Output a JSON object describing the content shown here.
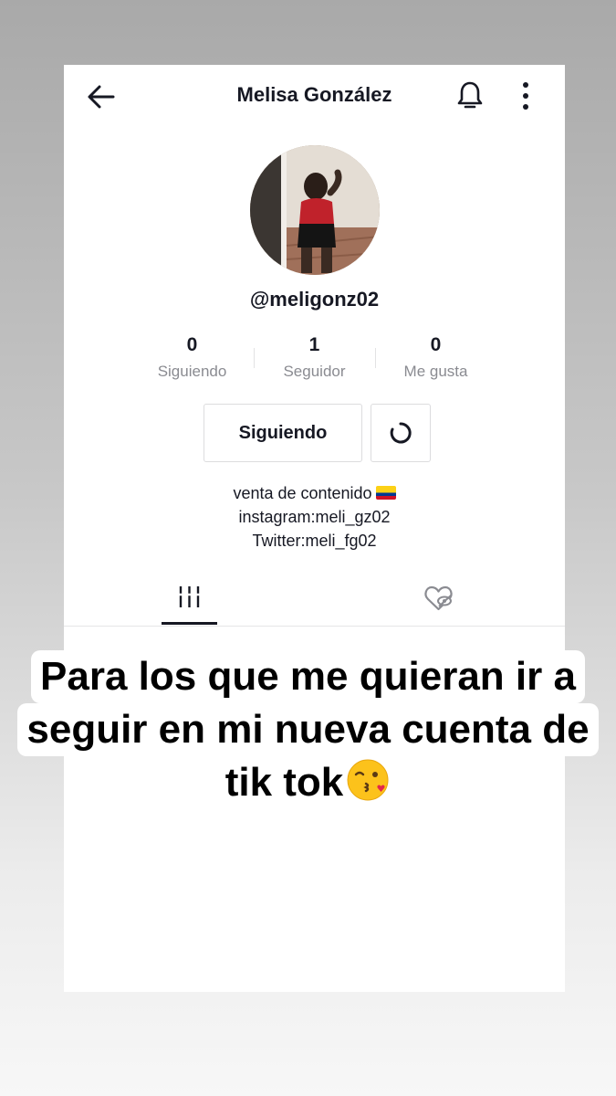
{
  "header": {
    "title": "Melisa González"
  },
  "profile": {
    "username": "@meligonz02",
    "stats": [
      {
        "value": "0",
        "label": "Siguiendo"
      },
      {
        "value": "1",
        "label": "Seguidor"
      },
      {
        "value": "0",
        "label": "Me gusta"
      }
    ],
    "follow_button_label": "Siguiendo",
    "bio": [
      "venta de contenido",
      "instagram:meli_gz02",
      "Twitter:meli_fg02"
    ]
  },
  "tabs": {
    "items": [
      {
        "icon": "grid-icon",
        "active": true
      },
      {
        "icon": "hidden-heart-icon",
        "active": false
      }
    ]
  },
  "caption": {
    "line1": "Para los que me quieran ir a",
    "line2": "seguir en mi nueva cuenta de",
    "line3": "tik tok"
  },
  "colors": {
    "text": "#161823",
    "secondary_text": "#8a8b91",
    "border": "#dcdcde"
  }
}
